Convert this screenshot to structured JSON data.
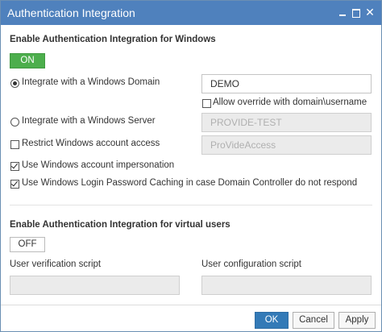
{
  "window": {
    "title": "Authentication Integration"
  },
  "windows_section": {
    "heading": "Enable Authentication Integration for Windows",
    "toggle_label": "ON",
    "integrate_domain_label": "Integrate with a Windows Domain",
    "domain_value": "DEMO",
    "allow_override_label": "Allow override with domain\\username",
    "integrate_server_label": "Integrate with a Windows Server",
    "server_value": "PROVIDE-TEST",
    "restrict_access_label": "Restrict Windows account access",
    "restrict_value": "ProVideAccess",
    "impersonation_label": "Use Windows account impersonation",
    "caching_label": "Use Windows Login Password Caching in case Domain Controller do not respond"
  },
  "virtual_section": {
    "heading": "Enable Authentication Integration for virtual users",
    "toggle_label": "OFF",
    "user_verification_label": "User verification script",
    "user_verification_value": "",
    "user_configuration_label": "User configuration script",
    "user_configuration_value": ""
  },
  "footer": {
    "ok_label": "OK",
    "cancel_label": "Cancel",
    "apply_label": "Apply"
  },
  "icons": {
    "minimize": "minimize-icon",
    "maximize": "maximize-icon",
    "close": "close-icon"
  },
  "colors": {
    "titlebar": "#4f81bd",
    "toggle_on": "#4cae4c",
    "primary_button": "#337ab7"
  }
}
